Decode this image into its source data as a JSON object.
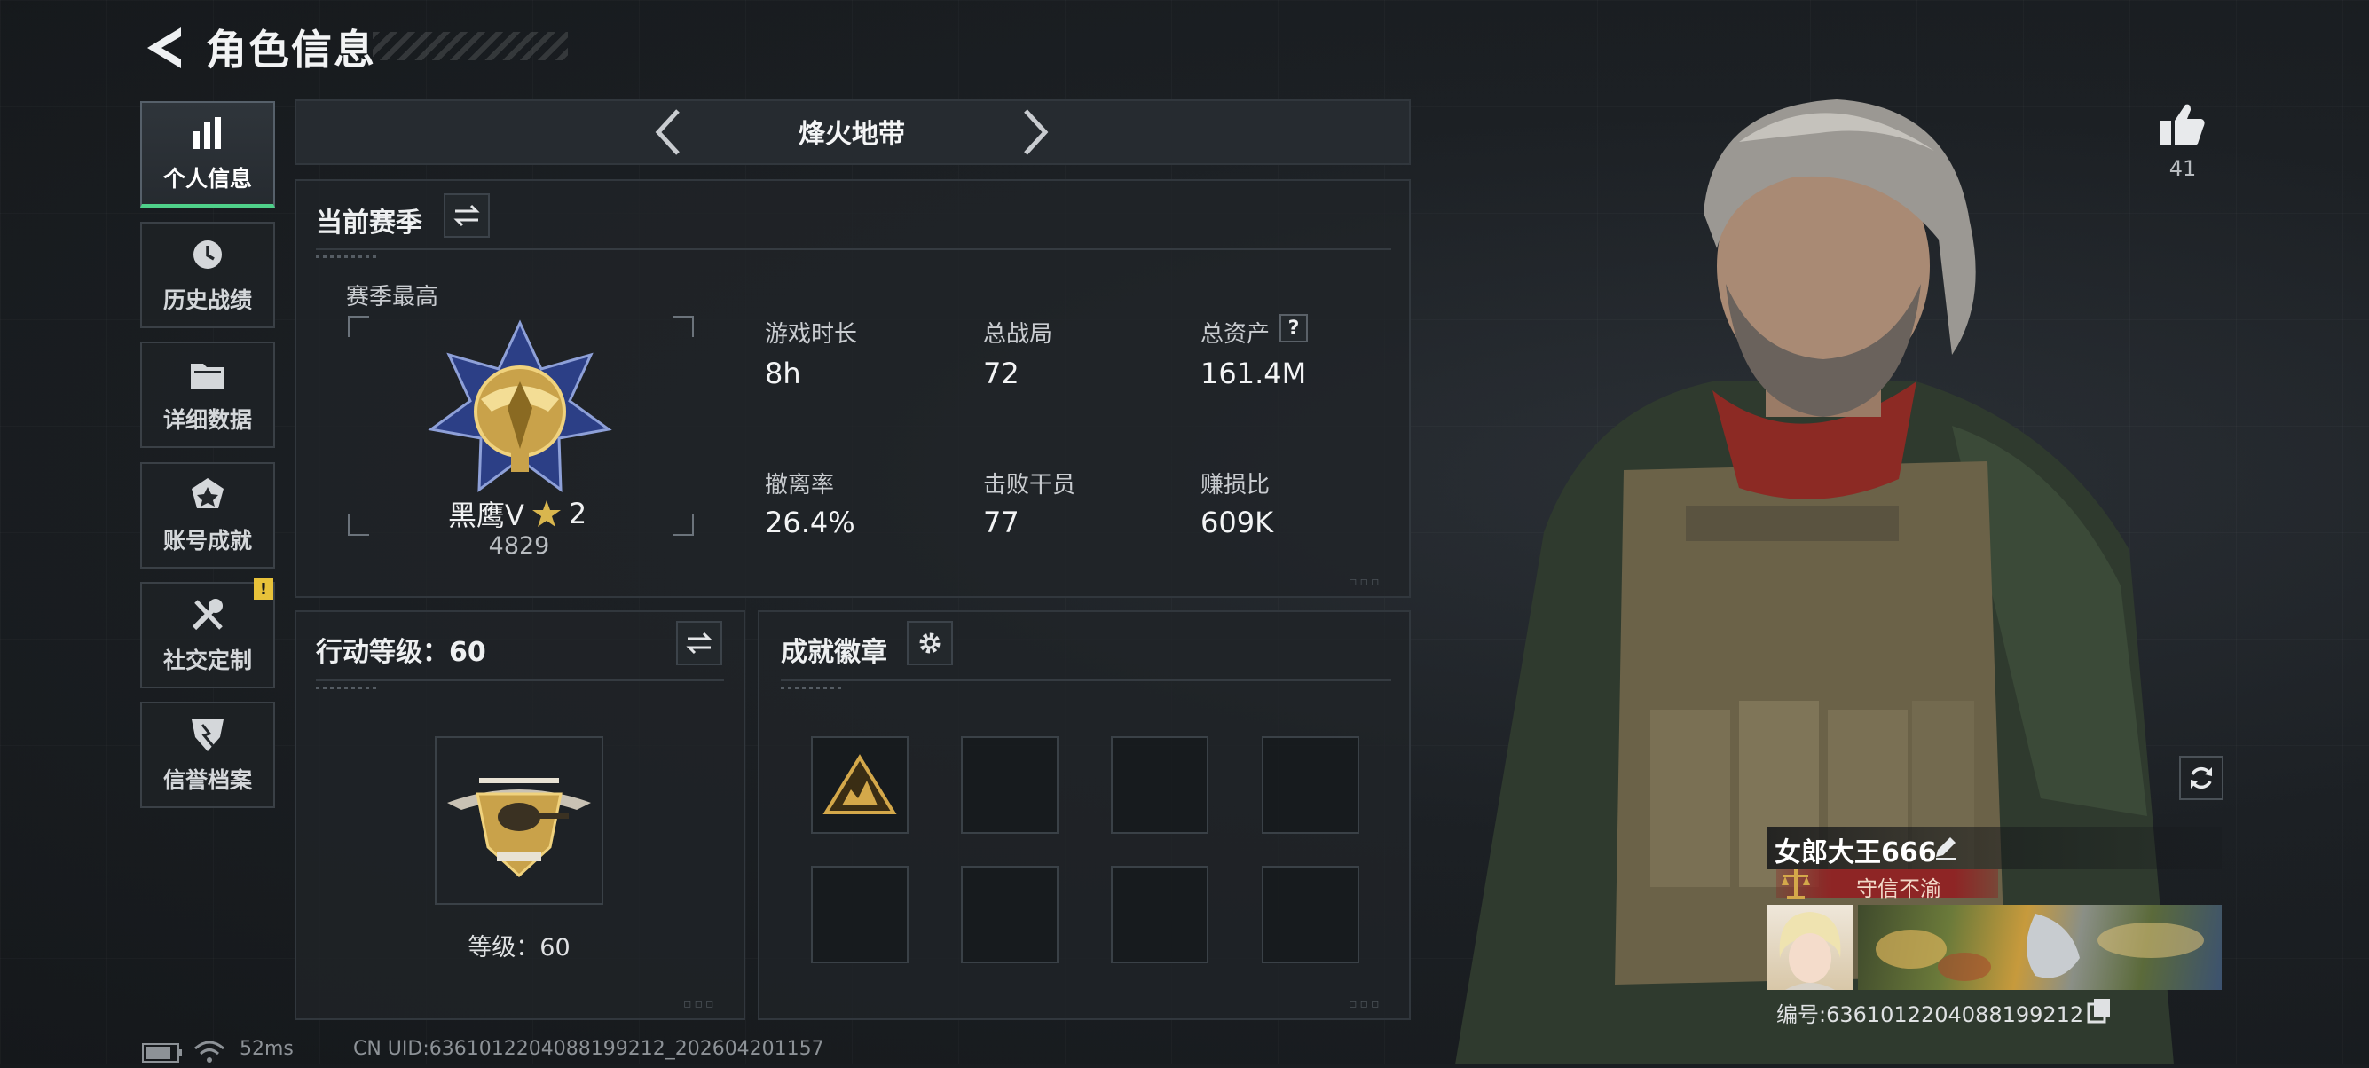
{
  "header": {
    "title": "角色信息"
  },
  "sidebar": {
    "items": [
      {
        "label": "个人信息"
      },
      {
        "label": "历史战绩"
      },
      {
        "label": "详细数据"
      },
      {
        "label": "账号成就"
      },
      {
        "label": "社交定制"
      },
      {
        "label": "信誉档案"
      }
    ],
    "warning_badge": "!"
  },
  "mode": {
    "title": "烽火地带"
  },
  "season": {
    "title": "当前赛季",
    "best_label": "赛季最高",
    "rank_name": "黑鹰V",
    "rank_stars": "2",
    "rank_score": "4829",
    "stats": [
      {
        "label": "游戏时长",
        "value": "8h"
      },
      {
        "label": "总战局",
        "value": "72"
      },
      {
        "label": "总资产",
        "value": "161.4M"
      },
      {
        "label": "撤离率",
        "value": "26.4%"
      },
      {
        "label": "击败干员",
        "value": "77"
      },
      {
        "label": "赚损比",
        "value": "609K"
      }
    ],
    "help_mark": "?"
  },
  "action_level": {
    "title": "行动等级：60",
    "level_text": "等级：60"
  },
  "achievements": {
    "title": "成就徽章",
    "filled_slots": 1,
    "total_slots": 8
  },
  "character": {
    "like_count": "41",
    "player_name": "女郎大王666",
    "honor_title": "守信不渝",
    "uid_text": "编号:6361012204088199212"
  },
  "status_bar": {
    "ping": "52ms",
    "footer_uid": "CN UID:6361012204088199212_202604201157"
  },
  "colors": {
    "accent_green": "#4fd08a",
    "warning_yellow": "#e8c23a",
    "title_red": "#8e2525",
    "gold": "#c9a24a"
  }
}
